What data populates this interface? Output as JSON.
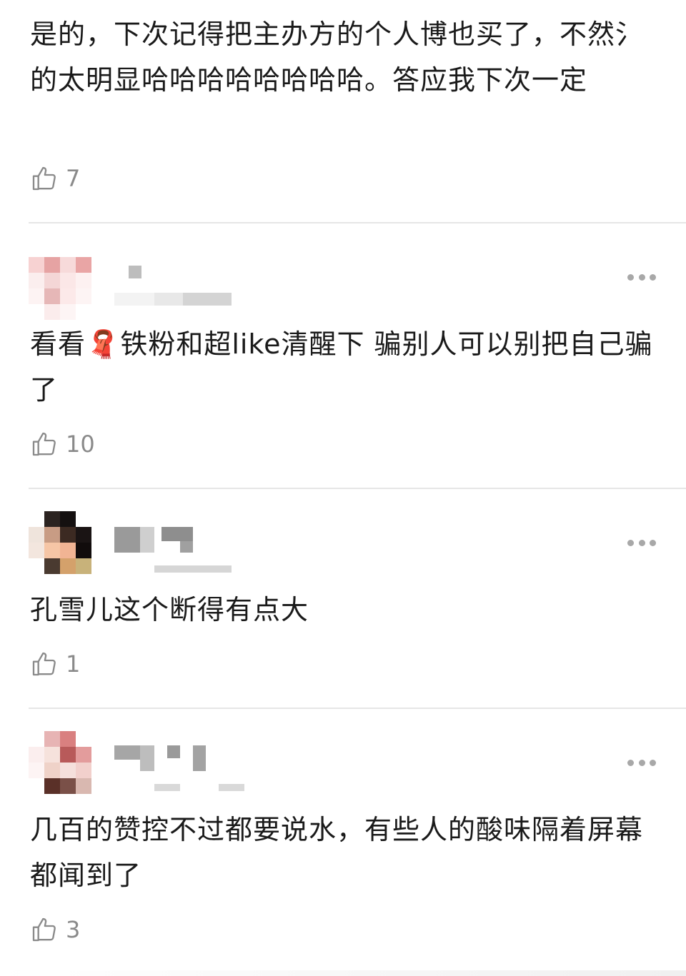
{
  "comments": [
    {
      "text": "是的，下次记得把主办方的个人博也买了，不然氵的太明显哈哈哈哈哈哈哈哈。答应我下次一定",
      "likes": "7"
    },
    {
      "text": "看看🧣铁粉和超like清醒下 骗别人可以别把自己骗了",
      "likes": "10"
    },
    {
      "text": "孔雪儿这个断得有点大",
      "likes": "1"
    },
    {
      "text": "几百的赞控不过都要说水，有些人的酸味隔着屏幕都闻到了",
      "likes": "3"
    }
  ],
  "icons": {
    "like": "thumbs-up-icon",
    "more": "more-horizontal-icon"
  },
  "colors": {
    "text": "#1a1a1a",
    "muted": "#8a8a8a",
    "divider": "#e6e6e6"
  }
}
